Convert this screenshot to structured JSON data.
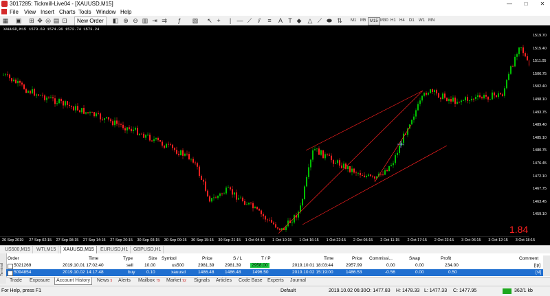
{
  "window": {
    "title": "3017285: Tickmill-Live04 - [XAUUSD,M15]",
    "controls": [
      "—",
      "□",
      "✕"
    ]
  },
  "menu": [
    "File",
    "View",
    "Insert",
    "Charts",
    "Tools",
    "Window",
    "Help"
  ],
  "toolbar": {
    "new_order": "New Order",
    "timeframes": [
      "M1",
      "M5",
      "M15",
      "M30",
      "H1",
      "H4",
      "D1",
      "W1",
      "MN"
    ],
    "active_timeframe": "M15"
  },
  "chart": {
    "symbol": "XAUUSD,M15",
    "ohlc": "1573.63 1574.36 1572.74 1573.24",
    "spread": "1.84",
    "price_labels": [
      "1519.70",
      "1515.40",
      "1511.05",
      "1506.75",
      "1502.40",
      "1498.10",
      "1493.75",
      "1489.40",
      "1485.10",
      "1480.75",
      "1476.45",
      "1472.10",
      "1467.75",
      "1463.45",
      "1459.10"
    ],
    "time_labels": [
      "26 Sep 2019",
      "27 Sep 02:15",
      "27 Sep 08:15",
      "27 Sep 14:15",
      "27 Sep 20:15",
      "30 Sep 03:15",
      "30 Sep 09:15",
      "30 Sep 15:15",
      "30 Sep 21:15",
      "1 Oct 04:15",
      "1 Oct 10:15",
      "1 Oct 16:15",
      "1 Oct 22:15",
      "2 Oct 05:15",
      "2 Oct 11:15",
      "2 Oct 17:15",
      "2 Oct 23:15",
      "3 Oct 06:15",
      "3 Oct 12:15",
      "3 Oct 18:15"
    ],
    "colors": {
      "bull": "#00c000",
      "bear": "#ff2020",
      "background": "#000000",
      "channel": "#ff2020"
    }
  },
  "symbol_tabs": [
    "US500,M15",
    "WTI,M15",
    "XAUUSD,M15",
    "EURUSD,H1",
    "GBPUSD,H1"
  ],
  "active_symbol_tab": "XAUUSD,M15",
  "terminal": {
    "side_label": "Terminal",
    "headers": {
      "order": "Order",
      "time": "Time",
      "type": "Type",
      "size": "Size",
      "symbol": "Symbol",
      "price": "Price",
      "sl": "S / L",
      "tp": "T / P",
      "time2": "Time",
      "price2": "Price",
      "commission": "Commissi...",
      "swap": "Swap",
      "profit": "Profit",
      "comment": "Comment"
    },
    "rows": [
      {
        "order": "5021269",
        "time": "2019.10.01 17:02:40",
        "type": "sell",
        "size": "10.00",
        "symbol": "us500",
        "price": "2981.39",
        "sl": "2981.39",
        "tp": "2958.00",
        "time2": "2019.10.01 18:03:44",
        "price2": "2957.99",
        "commission": "0.00",
        "swap": "0.00",
        "profit": "234.00",
        "comment": "[tp]"
      },
      {
        "order": "5094854",
        "time": "2019.10.02 14:17:48",
        "type": "buy",
        "size": "0.10",
        "symbol": "xauusd",
        "price": "1486.48",
        "sl": "1486.48",
        "tp": "1496.50",
        "time2": "2019.10.02 15:19:00",
        "price2": "1486.53",
        "commission": "-0.56",
        "swap": "0.00",
        "profit": "0.50",
        "comment": "[sl]"
      }
    ],
    "tabs": [
      {
        "label": "Trade"
      },
      {
        "label": "Exposure"
      },
      {
        "label": "Account History"
      },
      {
        "label": "News",
        "badge": "5"
      },
      {
        "label": "Alerts"
      },
      {
        "label": "Mailbox",
        "badge": "79"
      },
      {
        "label": "Market",
        "badge": "92"
      },
      {
        "label": "Signals"
      },
      {
        "label": "Articles"
      },
      {
        "label": "Code Base"
      },
      {
        "label": "Experts"
      },
      {
        "label": "Journal"
      }
    ],
    "active_tab": "Account History"
  },
  "status": {
    "help": "For Help, press F1",
    "profile": "Default",
    "datetime": "2019.10.02 06:30",
    "open": "O: 1477.83",
    "high": "H: 1478.33",
    "low": "L: 1477.33",
    "close": "C: 1477.95",
    "traffic": "362/1 kb"
  }
}
